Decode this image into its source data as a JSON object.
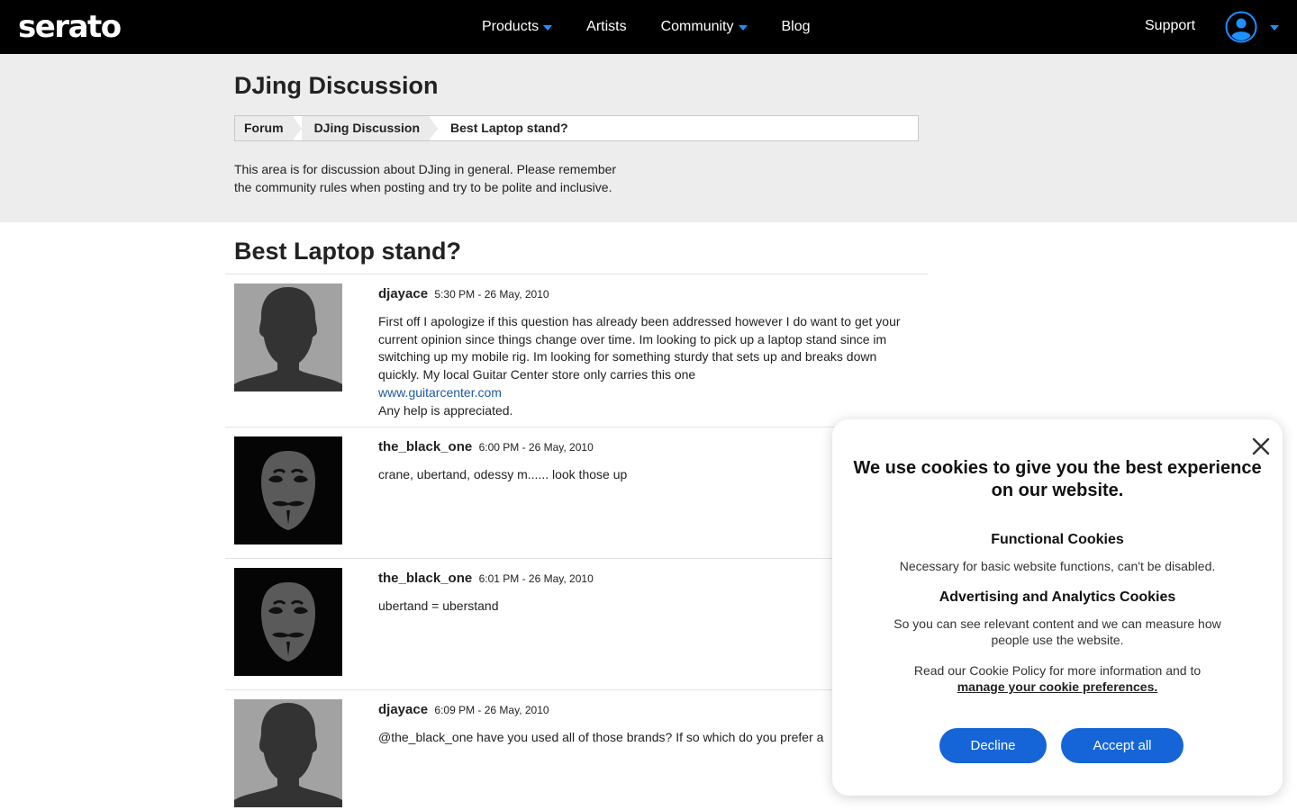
{
  "header": {
    "logo": "serato",
    "nav": [
      {
        "label": "Products",
        "dropdown": true
      },
      {
        "label": "Artists",
        "dropdown": false
      },
      {
        "label": "Community",
        "dropdown": true
      },
      {
        "label": "Blog",
        "dropdown": false
      }
    ],
    "support": "Support",
    "icons": {
      "user": "user-account-icon",
      "caret": "chevron-down-icon"
    },
    "accent_color": "#1e90ff"
  },
  "section": {
    "title": "DJing Discussion",
    "breadcrumb": [
      "Forum",
      "DJing Discussion",
      "Best Laptop stand?"
    ],
    "description_lines": [
      "This area is for discussion about DJing in general. Please remember",
      "the community rules when posting and try to be polite and inclusive."
    ]
  },
  "thread": {
    "title": "Best Laptop stand?",
    "posts": [
      {
        "author": "djayace",
        "time": "5:30 PM - 26 May, 2010",
        "avatar": "silhouette",
        "lines": [
          "First off I apologize if this question has already been addressed however I do want to get your",
          "current opinion since things change over time. Im looking to pick up a laptop stand since im",
          "switching up my mobile rig. Im looking for something sturdy that sets up and breaks down",
          "quickly. My local Guitar Center store only carries this one"
        ],
        "link": "www.guitarcenter.com",
        "after_link": "Any help is appreciated."
      },
      {
        "author": "the_black_one",
        "time": "6:00 PM - 26 May, 2010",
        "avatar": "mask",
        "lines": [
          "crane, ubertand, odessy m...... look those up"
        ]
      },
      {
        "author": "the_black_one",
        "time": "6:01 PM - 26 May, 2010",
        "avatar": "mask",
        "lines": [
          "ubertand = uberstand"
        ]
      },
      {
        "author": "djayace",
        "time": "6:09 PM - 26 May, 2010",
        "avatar": "silhouette",
        "lines": [
          "@the_black_one have you used all of those brands? If so which do you prefer a"
        ]
      }
    ]
  },
  "cookie": {
    "heading_lines": [
      "We use cookies to give you the best experience",
      "on our website."
    ],
    "functional_title": "Functional Cookies",
    "functional_text": "Necessary for basic website functions, can't be disabled.",
    "ads_title": "Advertising and Analytics Cookies",
    "ads_text_lines": [
      "So you can see relevant content and we can measure how",
      "people use the website."
    ],
    "policy_text": "Read our Cookie Policy for more information and to",
    "policy_link": "manage your cookie preferences.",
    "decline": "Decline",
    "accept": "Accept all",
    "button_color": "#1565d8",
    "close_icon": "close-icon"
  }
}
